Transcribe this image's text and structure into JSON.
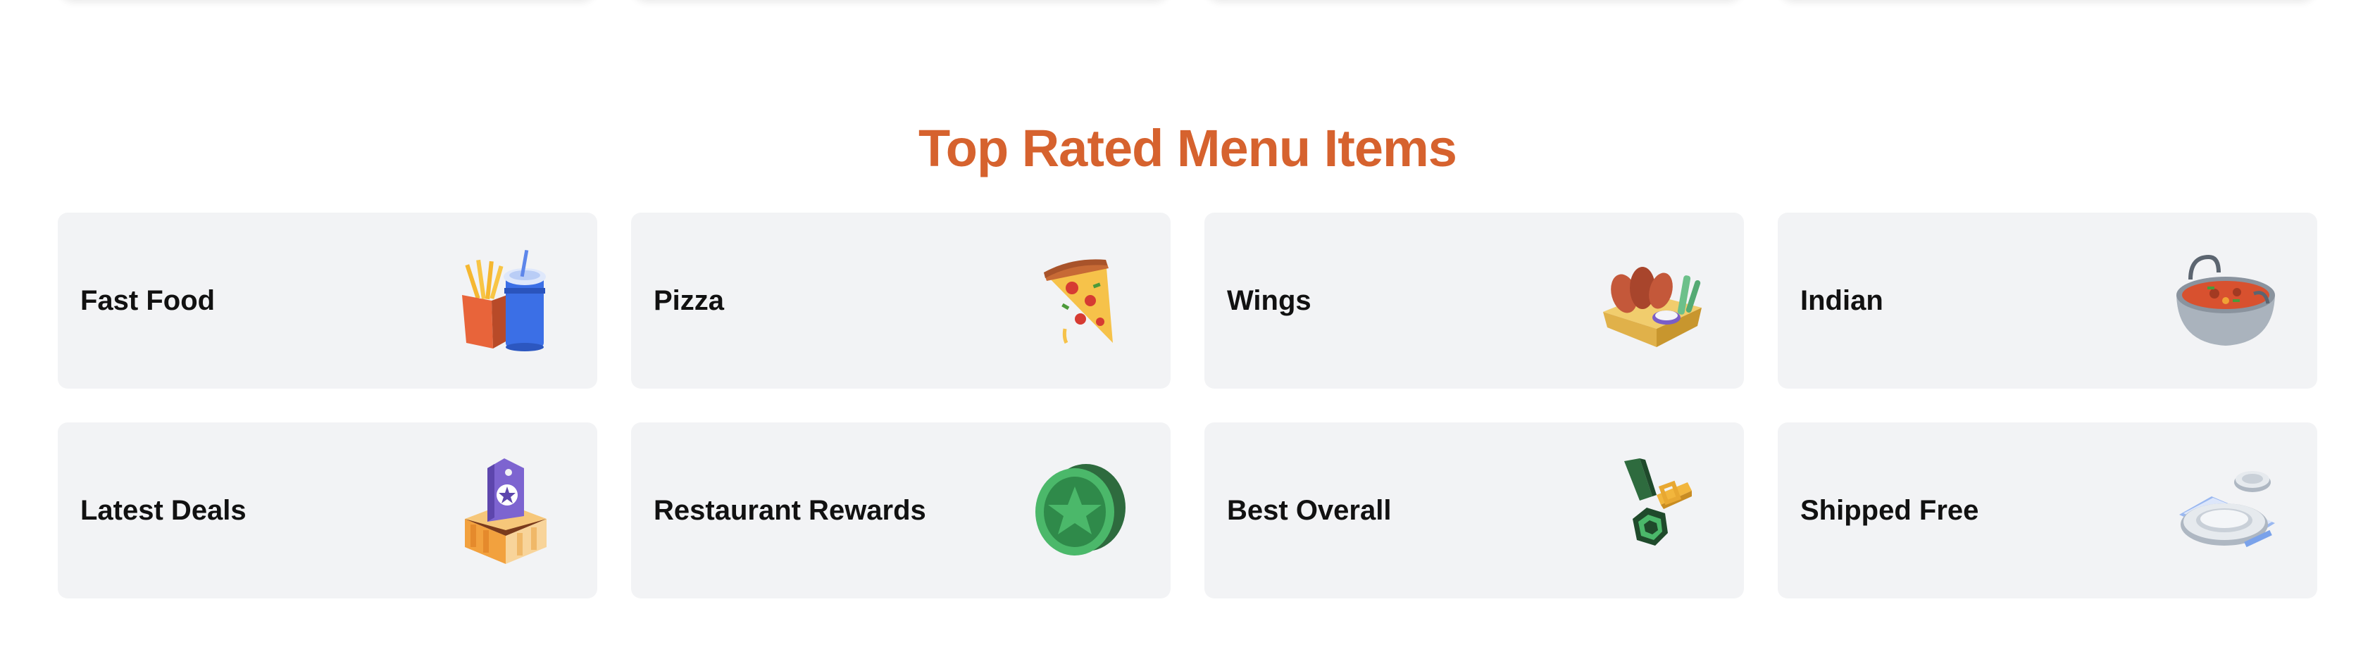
{
  "section": {
    "title": "Top Rated Menu Items"
  },
  "cards": [
    {
      "label": "Fast Food",
      "icon": "fries-and-drink-icon"
    },
    {
      "label": "Pizza",
      "icon": "pizza-slice-icon"
    },
    {
      "label": "Wings",
      "icon": "chicken-wings-icon"
    },
    {
      "label": "Indian",
      "icon": "curry-bowl-icon"
    },
    {
      "label": "Latest Deals",
      "icon": "price-tag-box-icon"
    },
    {
      "label": "Restaurant Rewards",
      "icon": "star-coin-icon"
    },
    {
      "label": "Best Overall",
      "icon": "ribbon-medal-icon"
    },
    {
      "label": "Shipped Free",
      "icon": "plates-icon"
    }
  ],
  "colors": {
    "title": "#d6622e",
    "card_bg": "#f2f3f5",
    "label": "#111111"
  }
}
